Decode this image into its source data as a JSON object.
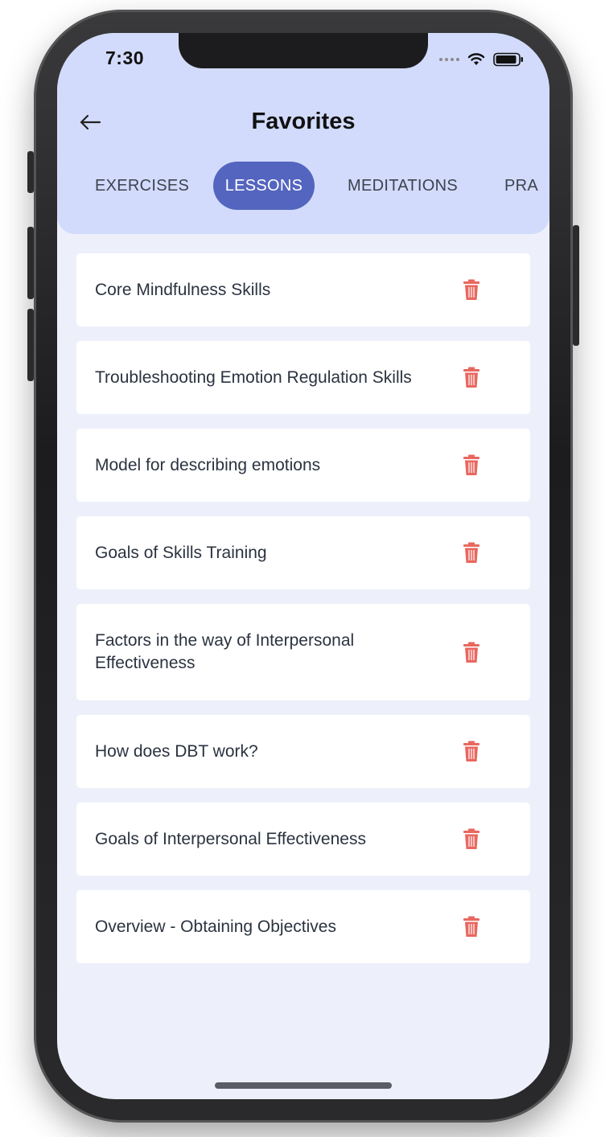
{
  "status_bar": {
    "time": "7:30"
  },
  "header": {
    "title": "Favorites"
  },
  "tabs": [
    {
      "label": "EXERCISES",
      "active": false
    },
    {
      "label": "LESSONS",
      "active": true
    },
    {
      "label": "MEDITATIONS",
      "active": false
    },
    {
      "label": "PRA",
      "active": false
    }
  ],
  "favorites": [
    {
      "label": "Core Mindfulness Skills"
    },
    {
      "label": "Troubleshooting Emotion Regulation Skills"
    },
    {
      "label": "Model for describing emotions"
    },
    {
      "label": "Goals of Skills Training"
    },
    {
      "label": "Factors in the way of Interpersonal Effectiveness"
    },
    {
      "label": "How does DBT work?"
    },
    {
      "label": "Goals of Interpersonal Effectiveness"
    },
    {
      "label": "Overview - Obtaining Objectives"
    }
  ],
  "icons": {
    "back": "arrow-left-icon",
    "delete": "trash-icon",
    "signal": "signal-dots-icon",
    "wifi": "wifi-icon",
    "battery": "battery-icon"
  },
  "colors": {
    "header_bg": "#d2dbfb",
    "active_tab": "#5465bf",
    "page_bg": "#edf0fb",
    "trash": "#e8675f"
  }
}
